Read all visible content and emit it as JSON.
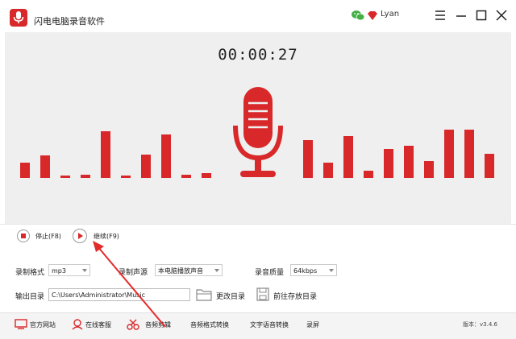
{
  "app": {
    "title": "闪电电脑录音软件",
    "username": "Lyan",
    "brand_color": "#d8282a"
  },
  "window_controls": [
    "menu-icon",
    "minimize-icon",
    "maximize-icon",
    "close-icon"
  ],
  "timer": "00:00:27",
  "levels_left": [
    0.3,
    0.44,
    0.04,
    0.06,
    0.91,
    0.04,
    0.45,
    0.84,
    0.07,
    0.09
  ],
  "levels_right": [
    0.74,
    0.3,
    0.82,
    0.14,
    0.56,
    0.62,
    0.33,
    0.94,
    0.94,
    0.47
  ],
  "controls": {
    "stop_label": "停止(F8)",
    "continue_label": "继续(F9)"
  },
  "settings": {
    "format_label": "录制格式",
    "format_value": "mp3",
    "source_label": "录制声源",
    "source_value": "本电脑播放声音",
    "quality_label": "录音质量",
    "quality_value": "64kbps",
    "output_label": "输出目录",
    "output_value": "C:\\Users\\Administrator\\Music",
    "change_dir_label": "更改目录",
    "open_dir_label": "前往存放目录"
  },
  "bottom": {
    "website": "官方网站",
    "support": "在线客服",
    "audio_edit": "音频剪辑",
    "format_convert": "音频格式转换",
    "tts": "文字语音转换",
    "screen_record": "录屏",
    "version": "版本：v3.4.6"
  }
}
